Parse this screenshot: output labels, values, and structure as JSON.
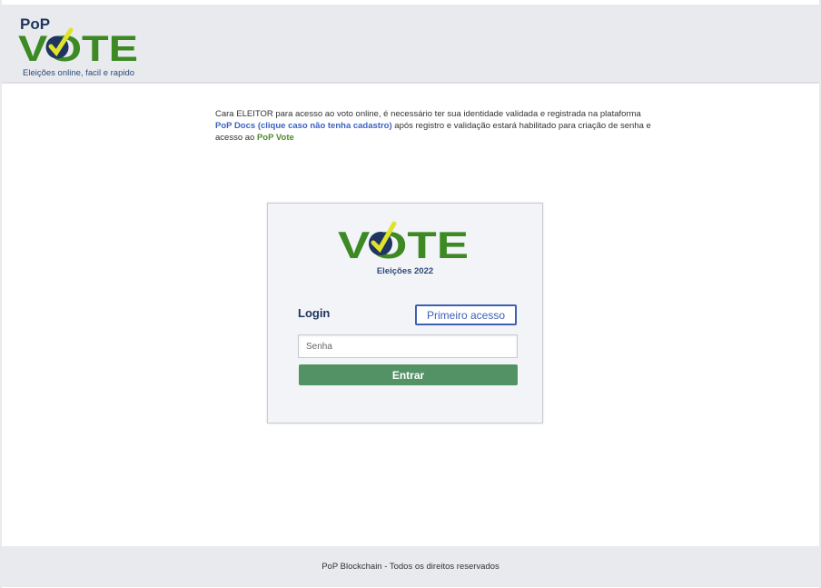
{
  "header": {
    "logo_small": "PoP",
    "logo_word": "VOTE",
    "tagline": "Eleições online, facil e rapido"
  },
  "intro": {
    "text_1": "Cara ELEITOR para acesso ao voto online, é necessário ter sua identidade validada e registrada na plataforma ",
    "link": "PoP Docs (clique caso não tenha cadastro)",
    "text_2": " após registro e validação estará habilitado para criação de senha e acesso ao ",
    "brand": "PoP Vote"
  },
  "card": {
    "logo_word": "VOTE",
    "subtitle": "Eleições 2022",
    "login_label": "Login",
    "first_access_label": "Primeiro acesso",
    "password_placeholder": "Senha",
    "submit_label": "Entrar"
  },
  "footer": {
    "text": "PoP Blockchain - Todos os direitos reservados"
  },
  "colors": {
    "green_dark": "#2e6a1f",
    "green_light": "#4fa22e",
    "check_yellow": "#dfe32c",
    "navy": "#1f3560",
    "button_green": "#539264",
    "link_blue": "#3b62c4"
  }
}
